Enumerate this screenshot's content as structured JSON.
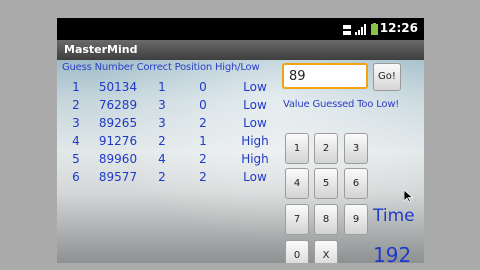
{
  "statusbar": {
    "time": "12:26"
  },
  "app": {
    "title": "MasterMind"
  },
  "table": {
    "header": "Guess Number Correct Position High/Low",
    "rows": [
      {
        "num": "1",
        "guess": "50134",
        "correct": "1",
        "position": "0",
        "hilo": "Low"
      },
      {
        "num": "2",
        "guess": "76289",
        "correct": "3",
        "position": "0",
        "hilo": "Low"
      },
      {
        "num": "3",
        "guess": "89265",
        "correct": "3",
        "position": "2",
        "hilo": "Low"
      },
      {
        "num": "4",
        "guess": "91276",
        "correct": "2",
        "position": "1",
        "hilo": "High"
      },
      {
        "num": "5",
        "guess": "89960",
        "correct": "4",
        "position": "2",
        "hilo": "High"
      },
      {
        "num": "6",
        "guess": "89577",
        "correct": "2",
        "position": "2",
        "hilo": "Low"
      }
    ]
  },
  "input": {
    "value": "89"
  },
  "go_label": "Go!",
  "feedback": "Value Guessed Too Low!",
  "keypad": {
    "k1": "1",
    "k2": "2",
    "k3": "3",
    "k4": "4",
    "k5": "5",
    "k6": "6",
    "k7": "7",
    "k8": "8",
    "k9": "9",
    "k0": "0",
    "kx": "X"
  },
  "timer": {
    "label": "Time",
    "value": "192"
  },
  "colors": {
    "text_blue": "#1f39c8",
    "input_border": "#f2a313"
  }
}
